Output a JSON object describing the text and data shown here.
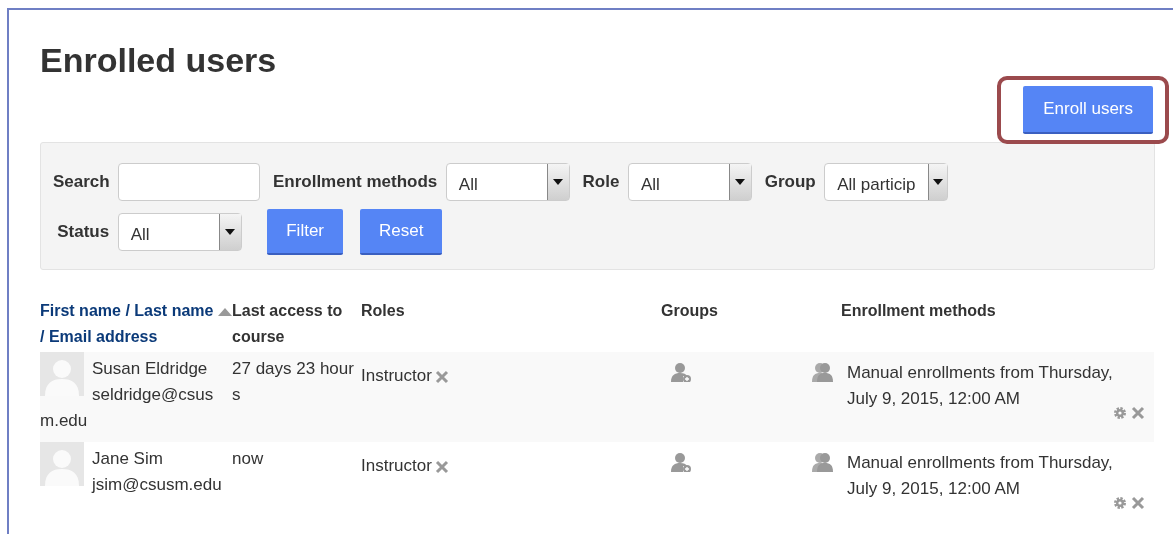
{
  "title": "Enrolled users",
  "enroll_button": {
    "label": "Enroll users",
    "highlighted": true
  },
  "filter": {
    "search": {
      "label": "Search"
    },
    "selects": [
      {
        "label": "Enrollment methods",
        "value": "All"
      },
      {
        "label": "Role",
        "value": "All"
      },
      {
        "label": "Group",
        "value": "All particip"
      },
      {
        "label": "Status",
        "value": "All"
      }
    ],
    "buttons": [
      {
        "label": "Filter"
      },
      {
        "label": "Reset"
      }
    ]
  },
  "table": {
    "columns": [
      {
        "kind": "sortable",
        "separator": "/",
        "parts": [
          {
            "label": "First name",
            "sorted": false
          },
          {
            "label": "Last name",
            "sorted": true
          },
          {
            "label": "Email address",
            "sorted": false
          }
        ]
      },
      {
        "kind": "plain",
        "label": "Last access to course"
      },
      {
        "kind": "plain",
        "label": "Roles"
      },
      {
        "kind": "plain",
        "label": "Groups"
      },
      {
        "kind": "plain",
        "label": "Enrollment methods"
      }
    ],
    "rows": [
      {
        "name": "Susan Eldridge",
        "email": "seldridge@csusm.edu",
        "last_access": "27 days 23 hours",
        "role": "Instructor",
        "enrollment": "Manual enrollments from Thursday, July 9, 2015, 12:00 AM"
      },
      {
        "name": "Jane Sim",
        "email": "jsim@csusm.edu",
        "last_access": "now",
        "role": "Instructor",
        "enrollment": "Manual enrollments from Thursday, July 9, 2015, 12:00 AM"
      }
    ]
  }
}
